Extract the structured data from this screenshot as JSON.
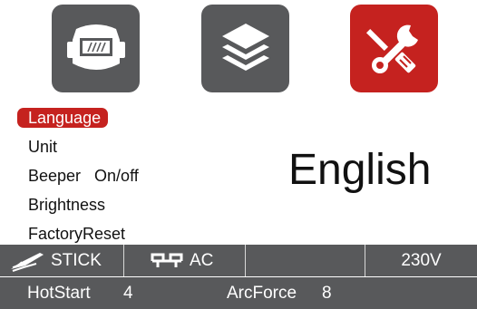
{
  "top_icons": [
    {
      "icon": "welding-helmet-icon"
    },
    {
      "icon": "layers-icon"
    },
    {
      "icon": "tools-icon"
    }
  ],
  "colors": {
    "accent": "#c5221f",
    "tile_gray": "#58595b",
    "status_bar": "#58595b"
  },
  "menu": {
    "items": [
      {
        "label": "Language",
        "selected": true
      },
      {
        "label": "Unit",
        "selected": false
      },
      {
        "label": "Beeper   On/off",
        "selected": false
      },
      {
        "label": "Brightness",
        "selected": false
      },
      {
        "label": "FactoryReset",
        "selected": false
      }
    ]
  },
  "setting": {
    "value": "English"
  },
  "status_bar": {
    "mode": "STICK",
    "mode_icon": "electrode-holder-icon",
    "current": "AC",
    "current_icon": "ac-wave-icon",
    "voltage": "230V"
  },
  "params": {
    "hotstart_label": "HotStart",
    "hotstart_value": "4",
    "arcforce_label": "ArcForce",
    "arcforce_value": "8"
  }
}
